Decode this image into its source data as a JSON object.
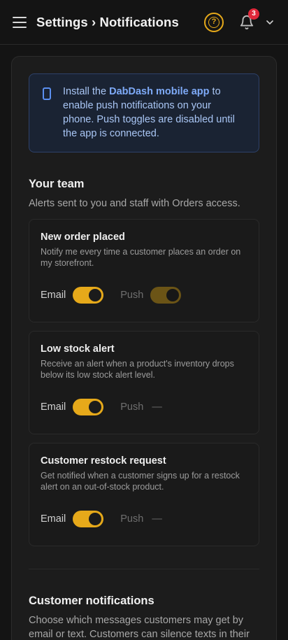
{
  "header": {
    "title": "Settings › Notifications",
    "notification_count": "3"
  },
  "info_banner": {
    "prefix": "Install the ",
    "app_name": "DabDash mobile app",
    "suffix": " to enable push notifications on your phone. Push toggles are disabled until the app is connected."
  },
  "team": {
    "title": "Your team",
    "subtitle": "Alerts sent to you and staff with Orders access.",
    "email_label": "Email",
    "push_label": "Push",
    "alerts": [
      {
        "title": "New order placed",
        "description": "Notify me every time a customer places an order on my storefront.",
        "email_on": true,
        "push": "toggle-disabled-on"
      },
      {
        "title": "Low stock alert",
        "description": "Receive an alert when a product's inventory drops below its low stock alert level.",
        "email_on": true,
        "push": "—"
      },
      {
        "title": "Customer restock request",
        "description": "Get notified when a customer signs up for a restock alert on an out-of-stock product.",
        "email_on": true,
        "push": "—"
      }
    ]
  },
  "customer": {
    "title": "Customer notifications",
    "subtitle": "Choose which messages customers may get by email or text. Customers can silence texts in their"
  },
  "colors": {
    "accent": "#e6a91a",
    "badge": "#e0283a",
    "info_bg": "#1a2333",
    "info_text": "#a9c6f5"
  }
}
